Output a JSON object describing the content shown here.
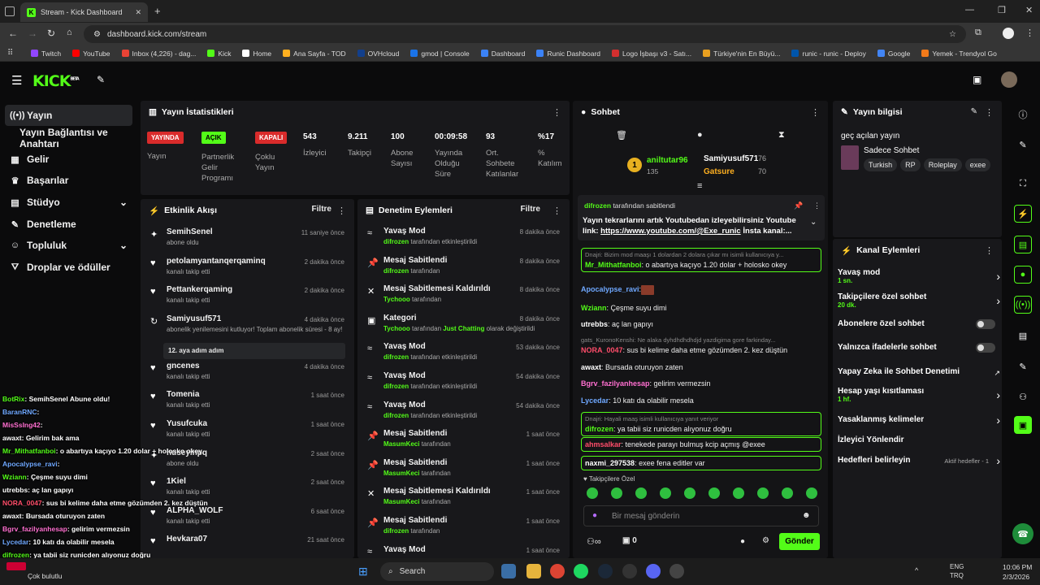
{
  "browser": {
    "tab_title": "Stream - Kick Dashboard",
    "url": "dashboard.kick.com/stream",
    "bookmarks": [
      "Twitch",
      "YouTube",
      "Inbox (4,226) - dag...",
      "Kick",
      "Home",
      "Ana Sayfa - TOD",
      "OVHcloud",
      "gmod | Console",
      "Dashboard",
      "Runic Dashboard",
      "Logo İşbaşı v3 - Satı...",
      "Türkiye'nin En Büyü...",
      "runic - runic - Deploy",
      "Google",
      "Yemek - Trendyol Go"
    ]
  },
  "header": {
    "logo": "KICK",
    "logo_beta": "BETA"
  },
  "nav": {
    "items": [
      "Yayın",
      "Yayın Bağlantısı ve Anahtarı",
      "Gelir",
      "Başarılar",
      "Stüdyo",
      "Denetleme",
      "Topluluk",
      "Droplar ve ödüller"
    ]
  },
  "stats": {
    "title": "Yayın İstatistikleri",
    "badges": [
      {
        "text": "YAYINDA",
        "label": "Yayın",
        "color": "#d92b2b"
      },
      {
        "text": "AÇIK",
        "label": "Partnerlik Gelir Programı",
        "color": "#53fc18"
      },
      {
        "text": "KAPALI",
        "label": "Çoklu Yayın",
        "color": "#d92b2b"
      }
    ],
    "metrics": [
      {
        "value": "543",
        "label": "İzleyici"
      },
      {
        "value": "9.211",
        "label": "Takipçi"
      },
      {
        "value": "100",
        "label": "Abone Sayısı"
      },
      {
        "value": "00:09:58",
        "label": "Yayında Olduğu Süre"
      },
      {
        "value": "93",
        "label": "Ort. Sohbete Katılanlar"
      },
      {
        "value": "%17",
        "label": "% Katılım"
      }
    ]
  },
  "activity": {
    "title": "Etkinlik Akışı",
    "filter": "Filtre",
    "items": [
      {
        "name": "SemihSenel",
        "sub": "abone oldu",
        "time": "11 saniye önce",
        "icon": "✦"
      },
      {
        "name": "petolamyantanqerqaminq",
        "sub": "kanalı takip etti",
        "time": "2 dakika önce",
        "icon": "♥"
      },
      {
        "name": "Pettankerqaming",
        "sub": "kanalı takip etti",
        "time": "2 dakika önce",
        "icon": "♥"
      },
      {
        "name": "Samiyusuf571",
        "sub": "abonelik yenilemesini kutluyor! Toplam abonelik süresi - 8 ay!",
        "time": "4 dakika önce",
        "icon": "↻",
        "msg": "12. aya adım adım"
      },
      {
        "name": "gncenes",
        "sub": "kanalı takip etti",
        "time": "4 dakika önce",
        "icon": "♥"
      },
      {
        "name": "Tomenia",
        "sub": "kanalı takip etti",
        "time": "1 saat önce",
        "icon": "♥"
      },
      {
        "name": "Yusufcuka",
        "sub": "kanalı takip etti",
        "time": "1 saat önce",
        "icon": "♥"
      },
      {
        "name": "huseyinpq",
        "sub": "abone oldu",
        "time": "2 saat önce",
        "icon": "✦"
      },
      {
        "name": "1Kiel",
        "sub": "kanalı takip etti",
        "time": "2 saat önce",
        "icon": "♥"
      },
      {
        "name": "ALPHA_WOLF",
        "sub": "kanalı takip etti",
        "time": "6 saat önce",
        "icon": "♥"
      },
      {
        "name": "Hevkara07",
        "sub": "",
        "time": "21 saat önce",
        "icon": "♥"
      }
    ]
  },
  "moderation": {
    "title": "Denetim Eylemleri",
    "filter": "Filtre",
    "items": [
      {
        "name": "Yavaş Mod",
        "actor": "difrozen",
        "sub": "tarafından etkinleştirildi",
        "time": "8 dakika önce",
        "icon": "≈"
      },
      {
        "name": "Mesaj Sabitlendi",
        "actor": "difrozen",
        "sub": "tarafından",
        "time": "8 dakika önce",
        "icon": "📌"
      },
      {
        "name": "Mesaj Sabitlemesi Kaldırıldı",
        "actor": "Tychooo",
        "sub": "tarafından",
        "time": "8 dakika önce",
        "icon": "✕"
      },
      {
        "name": "Kategori",
        "actor": "Tychooo",
        "sub": "tarafından",
        "extra": "Just Chatting",
        "extra_sub": "olarak değiştirildi",
        "time": "8 dakika önce",
        "icon": "▣"
      },
      {
        "name": "Yavaş Mod",
        "actor": "difrozen",
        "sub": "tarafından etkinleştirildi",
        "time": "53 dakika önce",
        "icon": "≈"
      },
      {
        "name": "Yavaş Mod",
        "actor": "difrozen",
        "sub": "tarafından etkinleştirildi",
        "time": "54 dakika önce",
        "icon": "≈"
      },
      {
        "name": "Yavaş Mod",
        "actor": "difrozen",
        "sub": "tarafından etkinleştirildi",
        "time": "54 dakika önce",
        "icon": "≈"
      },
      {
        "name": "Mesaj Sabitlendi",
        "actor": "MasumKeci",
        "sub": "tarafından",
        "time": "1 saat önce",
        "icon": "📌"
      },
      {
        "name": "Mesaj Sabitlendi",
        "actor": "MasumKeci",
        "sub": "tarafından",
        "time": "1 saat önce",
        "icon": "📌"
      },
      {
        "name": "Mesaj Sabitlemesi Kaldırıldı",
        "actor": "MasumKeci",
        "sub": "tarafından",
        "time": "1 saat önce",
        "icon": "✕"
      },
      {
        "name": "Mesaj Sabitlendi",
        "actor": "difrozen",
        "sub": "tarafından",
        "time": "1 saat önce",
        "icon": "📌"
      },
      {
        "name": "Yavaş Mod",
        "actor": "",
        "sub": "",
        "time": "1 saat önce",
        "icon": "≈"
      }
    ]
  },
  "chat": {
    "title": "Sohbet",
    "leaders": [
      {
        "rank": "1",
        "name": "aniltutar96",
        "count": "76",
        "sub": "135"
      },
      {
        "name": "Samiyusuf571",
        "count": "76"
      },
      {
        "name": "Gatsure",
        "count": "70"
      }
    ],
    "pinned": {
      "by": "difrozen",
      "by_sub": "tarafından sabitlendi",
      "text": "Yayın tekrarlarını artık Youtubedan izleyebilirsiniz Youtube link:",
      "link": "https://www.youtube.com/@Exe_runic",
      "rest": "İnsta kanal:..."
    },
    "messages": [
      {
        "reply": "Dnajri: Bizim mod maaşı 1 dolardan 2 dolara çıkar mı isimli kullanıcıya y...",
        "user": "Mr_Mithatfanboi",
        "color": "#53fc18",
        "text": ": o abartıya kaçıyo 1.20 dolar + holosko okey",
        "box": true
      },
      {
        "user": "Apocalypse_ravi",
        "color": "#6fa8ff",
        "text": ":",
        "emote": true
      },
      {
        "user": "Wziann",
        "color": "#53fc18",
        "text": ": Çeşme suyu dimi"
      },
      {
        "user": "utrebbs",
        "color": "#ffffff",
        "text": ": aç lan gapıyı"
      },
      {
        "reply": "gats_KuronoKenshi: Ne alaka dyhdhdhdhdjd yazdigima gore farkinday...",
        "user": "NORA_0047",
        "color": "#ff4d6a",
        "text": ": sus bi kelime daha etme gözümden 2. kez düştün"
      },
      {
        "user": "awaxt",
        "color": "#ffffff",
        "text": ": Bursada oturuyon zaten"
      },
      {
        "user": "Bgrv_fazilyanhesap",
        "color": "#ff6fd0",
        "text": ": gelirim vermezsin"
      },
      {
        "user": "Lycedar",
        "color": "#6fa8ff",
        "text": ": 10 katı da olabilir mesela"
      },
      {
        "reply": "Dnajri: Hayali maaş isimli kullanıcıya yanıt veriyor",
        "user": "difrozen",
        "color": "#53fc18",
        "text": ": ya tabii siz runicden alıyonuz doğru",
        "box": true
      },
      {
        "user": "ahmsalkar",
        "color": "#ff4d6a",
        "text": ": tenekede parayı bulmuş kcip açmış @exee",
        "box": true
      },
      {
        "user": "naxmi_297538",
        "color": "#ffffff",
        "text": ": exee fena editler var",
        "box": true
      }
    ],
    "emote_label": "Takipçilere Özel",
    "input_placeholder": "Bir mesaj gönderin",
    "points": "0",
    "send": "Gönder"
  },
  "stream_info": {
    "title": "Yayın bilgisi",
    "stream_title": "geç açılan yayın",
    "category": "Sadece Sohbet",
    "tags": [
      "Turkish",
      "RP",
      "Roleplay",
      "exee"
    ]
  },
  "channel_actions": {
    "title": "Kanal Eylemleri",
    "items": [
      {
        "label": "Yavaş mod",
        "sub": "1 sn.",
        "type": "chevron"
      },
      {
        "label": "Takipçilere özel sohbet",
        "sub": "20 dk.",
        "type": "chevron"
      },
      {
        "label": "Abonelere özel sohbet",
        "sub": "",
        "type": "toggle"
      },
      {
        "label": "Yalnızca ifadelerle sohbet",
        "sub": "",
        "type": "toggle"
      },
      {
        "label": "Yapay Zeka ile Sohbet Denetimi",
        "sub": "",
        "type": "external"
      },
      {
        "label": "Hesap yaşı kısıtlaması",
        "sub": "1 hf.",
        "type": "chevron"
      },
      {
        "label": "Yasaklanmış kelimeler",
        "sub": "",
        "type": "chevron"
      },
      {
        "label": "İzleyici Yönlendir",
        "sub": "",
        "type": "none"
      },
      {
        "label": "Hedefleri belirleyin",
        "sub": "",
        "type": "chevron",
        "extra": "Aktif hedefler - 1"
      }
    ]
  },
  "overlay_chat": [
    {
      "user": "BotRix",
      "color": "#53fc18",
      "text": ": SemihSenel Abune oldu!"
    },
    {
      "user": "BaranRNC",
      "color": "#6fa8ff",
      "text": ":"
    },
    {
      "user": "MisSsIng42",
      "color": "#ff6fd0",
      "text": ":"
    },
    {
      "user": "awaxt",
      "color": "#ffffff",
      "text": ": Gelirim bak ama"
    },
    {
      "user": "Mr_Mithatfanboi",
      "color": "#53fc18",
      "text": ": o abartıya kaçıyo 1.20 dolar + holosko okey"
    },
    {
      "user": "Apocalypse_ravi",
      "color": "#6fa8ff",
      "text": ":"
    },
    {
      "user": "Wziann",
      "color": "#53fc18",
      "text": ": Çeşme suyu dimi"
    },
    {
      "user": "utrebbs",
      "color": "#ffffff",
      "text": ": aç lan gapıyı"
    },
    {
      "user": "NORA_0047",
      "color": "#ff4d6a",
      "text": ": sus bi kelime daha etme gözümden 2. kez düştün"
    },
    {
      "user": "awaxt",
      "color": "#ffffff",
      "text": ": Bursada oturuyon zaten"
    },
    {
      "user": "Bgrv_fazilyanhesap",
      "color": "#ff6fd0",
      "text": ": gelirim vermezsin"
    },
    {
      "user": "Lycedar",
      "color": "#6fa8ff",
      "text": ": 10 katı da olabilir mesela"
    },
    {
      "user": "difrozen",
      "color": "#53fc18",
      "text": ": ya tabii siz runicden alıyonuz doğru"
    },
    {
      "user": "ahmsalkar",
      "color": "#ff4d6a",
      "text": ": tenekede parayı bulmuş kcip açmış @exee"
    }
  ],
  "taskbar": {
    "weather": "Çok bulutlu",
    "search": "Search",
    "lang1": "ENG",
    "lang2": "TRQ",
    "time": "10:06 PM",
    "date": "2/3/2026"
  }
}
